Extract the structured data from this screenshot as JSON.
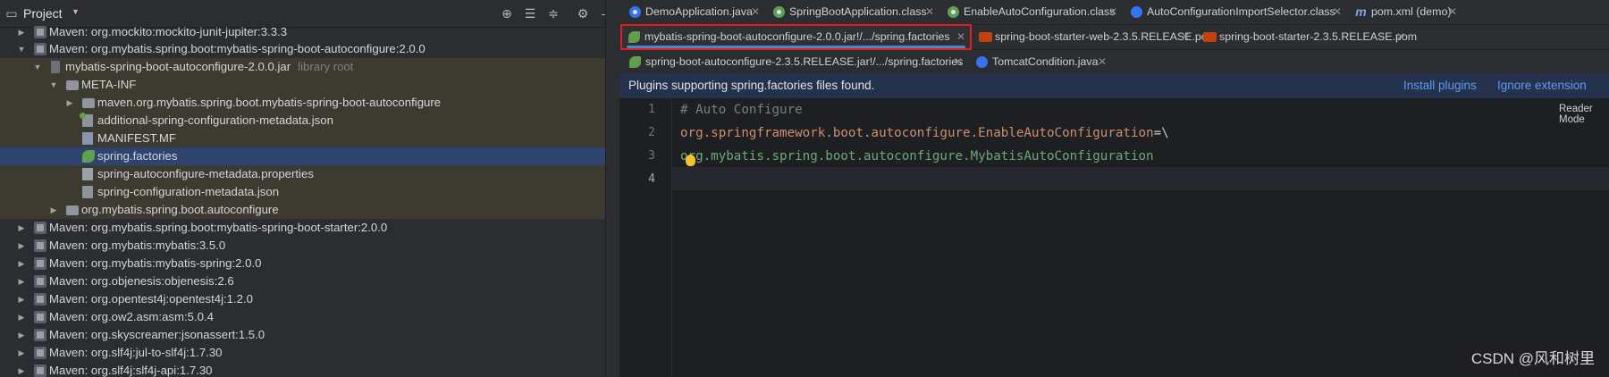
{
  "project": {
    "title": "Project",
    "items": [
      {
        "label": "Maven: org.mockito:mockito-junit-jupiter:3.3.3"
      },
      {
        "label": "Maven: org.mybatis.spring.boot:mybatis-spring-boot-autoconfigure:2.0.0"
      },
      {
        "label": "mybatis-spring-boot-autoconfigure-2.0.0.jar",
        "hint": "library root"
      },
      {
        "label": "META-INF"
      },
      {
        "label": "maven.org.mybatis.spring.boot.mybatis-spring-boot-autoconfigure"
      },
      {
        "label": "additional-spring-configuration-metadata.json"
      },
      {
        "label": "MANIFEST.MF"
      },
      {
        "label": "spring.factories"
      },
      {
        "label": "spring-autoconfigure-metadata.properties"
      },
      {
        "label": "spring-configuration-metadata.json"
      },
      {
        "label": "org.mybatis.spring.boot.autoconfigure"
      },
      {
        "label": "Maven: org.mybatis.spring.boot:mybatis-spring-boot-starter:2.0.0"
      },
      {
        "label": "Maven: org.mybatis:mybatis:3.5.0"
      },
      {
        "label": "Maven: org.mybatis:mybatis-spring:2.0.0"
      },
      {
        "label": "Maven: org.objenesis:objenesis:2.6"
      },
      {
        "label": "Maven: org.opentest4j:opentest4j:1.2.0"
      },
      {
        "label": "Maven: org.ow2.asm:asm:5.0.4"
      },
      {
        "label": "Maven: org.skyscreamer:jsonassert:1.5.0"
      },
      {
        "label": "Maven: org.slf4j:jul-to-slf4j:1.7.30"
      },
      {
        "label": "Maven: org.slf4j:slf4j-api:1.7.30"
      }
    ]
  },
  "tabs": {
    "row1": [
      {
        "label": "DemoApplication.java",
        "icon": "java-class-icon"
      },
      {
        "label": "SpringBootApplication.class",
        "icon": "annotation-icon"
      },
      {
        "label": "EnableAutoConfiguration.class",
        "icon": "annotation-icon"
      },
      {
        "label": "AutoConfigurationImportSelector.class",
        "icon": "class-icon"
      },
      {
        "label": "pom.xml (demo)",
        "icon": "maven-icon"
      }
    ],
    "row2": [
      {
        "label": "mybatis-spring-boot-autoconfigure-2.0.0.jar!/.../spring.factories",
        "icon": "spring-icon"
      },
      {
        "label": "spring-boot-starter-web-2.3.5.RELEASE.pom",
        "icon": "pom-icon"
      },
      {
        "label": "spring-boot-starter-2.3.5.RELEASE.pom",
        "icon": "pom-icon"
      }
    ],
    "row3": [
      {
        "label": "spring-boot-autoconfigure-2.3.5.RELEASE.jar!/.../spring.factories",
        "icon": "spring-icon"
      },
      {
        "label": "TomcatCondition.java",
        "icon": "class-icon"
      }
    ]
  },
  "banner": {
    "message": "Plugins supporting spring.factories files found.",
    "install": "Install plugins",
    "ignore": "Ignore extension"
  },
  "editor": {
    "reader_mode": "Reader Mode",
    "line_numbers": [
      "1",
      "2",
      "3",
      "4"
    ],
    "lines": {
      "comment": "# Auto Configure",
      "key": "org.springframework.boot.autoconfigure.EnableAutoConfiguration",
      "op": "=\\",
      "value": "org.mybatis.spring.boot.autoconfigure.MybatisAutoConfiguration"
    }
  },
  "watermark": "CSDN @风和树里",
  "colors": {
    "highlight_box": "#e02020",
    "selection": "#2e436e",
    "library_bg": "#3d3b2f",
    "banner_bg": "#25324d",
    "link": "#5b9cf2"
  }
}
